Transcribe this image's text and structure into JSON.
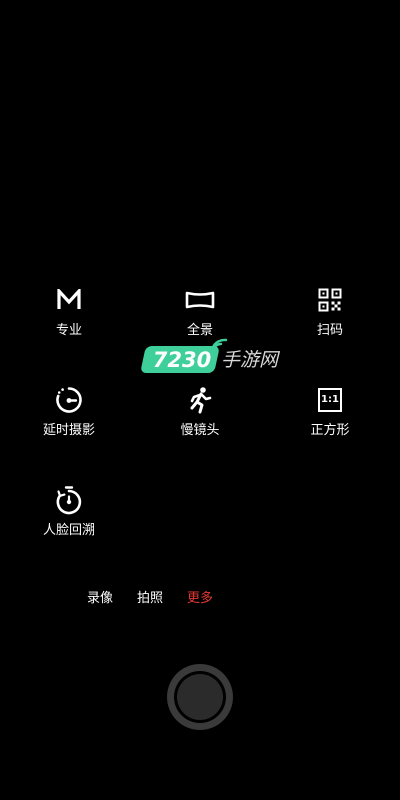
{
  "modes": [
    {
      "label": "专业",
      "icon": "manual-mode-m-icon"
    },
    {
      "label": "全景",
      "icon": "panorama-icon"
    },
    {
      "label": "扫码",
      "icon": "qr-code-icon"
    },
    {
      "label": "延时摄影",
      "icon": "timelapse-icon"
    },
    {
      "label": "慢镜头",
      "icon": "slow-motion-runner-icon"
    },
    {
      "label": "正方形",
      "icon": "square-ratio-icon",
      "icon_text": "1:1"
    },
    {
      "label": "人脸回溯",
      "icon": "face-backtrack-timer-icon"
    }
  ],
  "tabs": [
    {
      "label": "录像",
      "active": false
    },
    {
      "label": "拍照",
      "active": false
    },
    {
      "label": "更多",
      "active": true
    }
  ],
  "watermark": {
    "number": "7230",
    "text": "手游网"
  },
  "colors": {
    "background": "#000000",
    "text": "#ffffff",
    "active_tab": "#e53935",
    "watermark_green": "#3ecf9a"
  }
}
